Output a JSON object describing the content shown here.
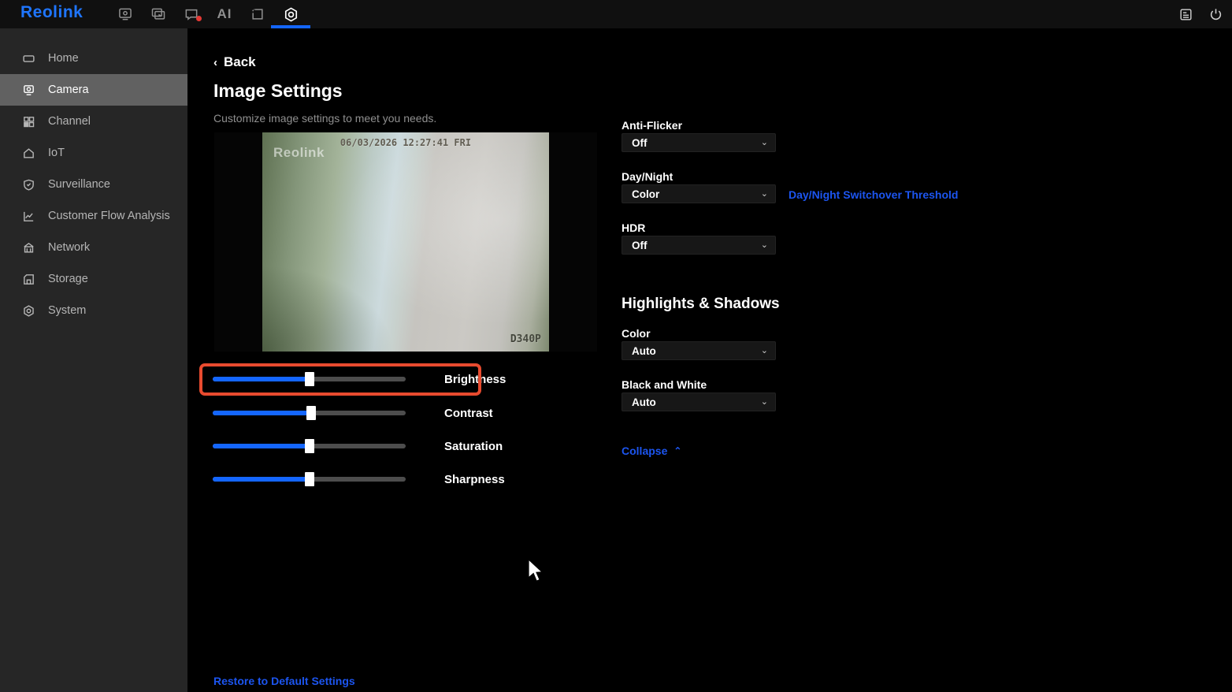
{
  "topbar": {
    "logo": "Reolink",
    "ai_label": "AI",
    "nav": [
      {
        "key": "live-view",
        "icon": "monitor-icon"
      },
      {
        "key": "playback",
        "icon": "playback-icon"
      },
      {
        "key": "alarm-messages",
        "icon": "message-bubble-icon",
        "badge": true
      },
      {
        "key": "ai",
        "icon": "ai-icon"
      },
      {
        "key": "display",
        "icon": "display-frame-icon"
      },
      {
        "key": "settings",
        "icon": "gear-icon",
        "active": true
      }
    ],
    "right": [
      {
        "key": "system-log",
        "icon": "log-icon"
      },
      {
        "key": "power",
        "icon": "power-icon"
      }
    ]
  },
  "sidebar": {
    "items": [
      {
        "label": "Home",
        "active": false
      },
      {
        "label": "Camera",
        "active": true
      },
      {
        "label": "Channel",
        "active": false
      },
      {
        "label": "IoT",
        "active": false
      },
      {
        "label": "Surveillance",
        "active": false
      },
      {
        "label": "Customer Flow Analysis",
        "active": false
      },
      {
        "label": "Network",
        "active": false
      },
      {
        "label": "Storage",
        "active": false
      },
      {
        "label": "System",
        "active": false
      }
    ]
  },
  "main": {
    "back_label": "Back",
    "back_chevron": "‹",
    "title": "Image Settings",
    "subtitle": "Customize image settings to meet you needs.",
    "preview": {
      "timestamp": "06/03/2026 12:27:41 FRI",
      "watermark": "Reolink",
      "camera_model": "D340P"
    },
    "sliders": [
      {
        "label": "Brightness",
        "value_percent": 50,
        "highlighted": true
      },
      {
        "label": "Contrast",
        "value_percent": 51,
        "highlighted": false
      },
      {
        "label": "Saturation",
        "value_percent": 50,
        "highlighted": false
      },
      {
        "label": "Sharpness",
        "value_percent": 50,
        "highlighted": false
      }
    ],
    "restore_label": "Restore to Default Settings"
  },
  "settings": {
    "anti_flicker": {
      "label": "Anti-Flicker",
      "value": "Off"
    },
    "day_night": {
      "label": "Day/Night",
      "value": "Color"
    },
    "day_night_link": "Day/Night Switchover Threshold",
    "hdr": {
      "label": "HDR",
      "value": "Off"
    },
    "section_title": "Highlights & Shadows",
    "hs_color": {
      "label": "Color",
      "value": "Auto"
    },
    "black_white": {
      "label": "Black and White",
      "value": "Auto"
    },
    "collapse_label": "Collapse",
    "collapse_chevron": "⌃",
    "dropdown_chevron": "⌄"
  },
  "colors": {
    "accent_blue": "#1466ff",
    "link_blue": "#1c55f0",
    "logo_blue": "#1f76ff",
    "highlight_red": "#e84b2f",
    "sidebar_bg": "#262626",
    "sidebar_active_bg": "#616161",
    "topbar_bg": "#101010",
    "main_bg": "#000000",
    "alert_dot": "#e53935"
  }
}
